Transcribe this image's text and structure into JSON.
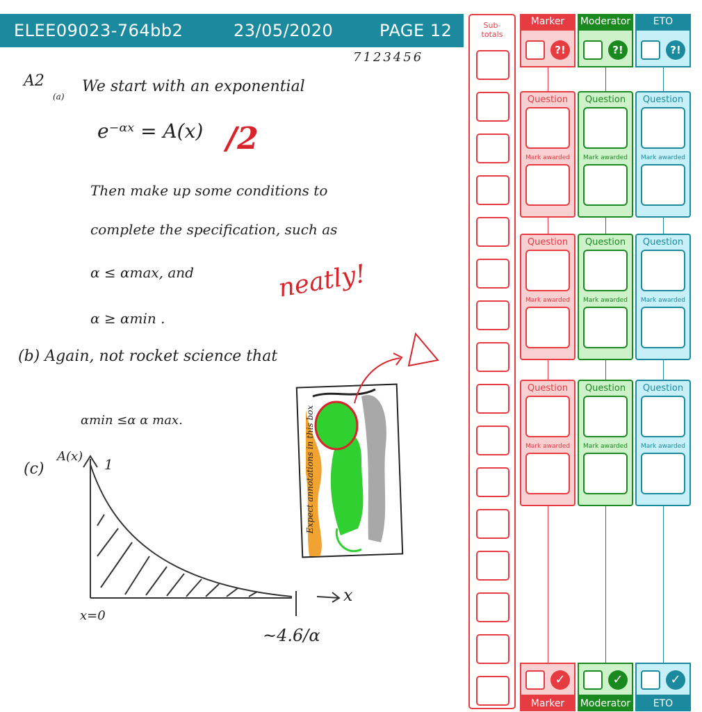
{
  "header": {
    "code": "ELEE09023-764bb2",
    "date": "23/05/2020",
    "page": "PAGE 12"
  },
  "student_number": "7123456",
  "answer": {
    "a2": "A2",
    "part_a": "(a)",
    "line1": "We start with an exponential",
    "equation": "e⁻ᵅˣ = A(x)",
    "line2": "Then make up some conditions to",
    "line3": "complete the specification, such as",
    "line4": "α ≤ αmax, and",
    "line5": "α ≥ αmin .",
    "part_b": "(b) Again, not rocket science that",
    "line6": "αmin  ≤α  α max.",
    "part_c": "(c)",
    "graph_ylabel": "A(x)",
    "graph_one": "1",
    "graph_xvar": "x",
    "graph_origin": "x=0",
    "graph_end": "~4.6/α"
  },
  "annotations": {
    "mark": "/2",
    "comment": "neatly!",
    "box_caption": "Expect annotations in this box"
  },
  "subtotals_title": "Sub-totals",
  "roles": [
    {
      "key": "marker",
      "name": "Marker",
      "color": "#e63b40",
      "light": "#f9d0d1",
      "flag": "?!",
      "check": "✓"
    },
    {
      "key": "moderator",
      "name": "Moderator",
      "color": "#1a8a20",
      "light": "#cdf2c9",
      "flag": "?!",
      "check": "✓"
    },
    {
      "key": "eto",
      "name": "ETO",
      "color": "#1b8a9f",
      "light": "#c6eff8",
      "flag": "?!",
      "check": "✓"
    }
  ],
  "question_label": "Question",
  "mark_awarded_label": "Mark awarded"
}
